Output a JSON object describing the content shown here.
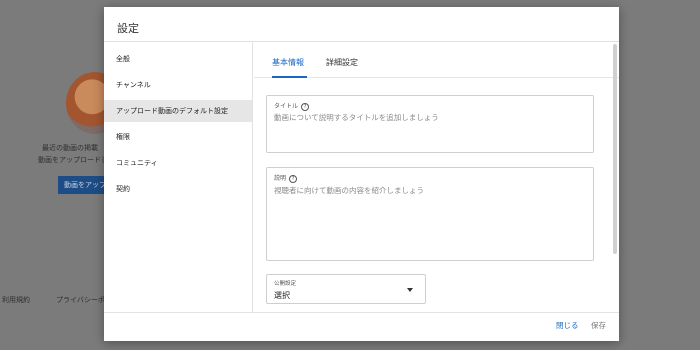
{
  "background": {
    "caption_line1": "最近の動画の掲載",
    "caption_line2": "動画をアップロードし",
    "upload_button": "動画をアップ",
    "footer_link_1": "利用規約",
    "footer_link_2": "プライバシーポ"
  },
  "dialog": {
    "title": "設定",
    "sidebar": {
      "items": [
        {
          "label": "全般"
        },
        {
          "label": "チャンネル"
        },
        {
          "label": "アップロード動画のデフォルト設定"
        },
        {
          "label": "権限"
        },
        {
          "label": "コミュニティ"
        },
        {
          "label": "契約"
        }
      ],
      "active_index": 2
    },
    "tabs": [
      {
        "label": "基本情報"
      },
      {
        "label": "詳細設定"
      }
    ],
    "title_field": {
      "label": "タイトル",
      "placeholder": "動画について説明するタイトルを追加しましょう"
    },
    "description_field": {
      "label": "説明",
      "placeholder": "視聴者に向けて動画の内容を紹介しましょう"
    },
    "visibility_select": {
      "label": "公開設定",
      "value": "選択"
    },
    "footer": {
      "close": "閉じる",
      "save": "保存"
    }
  },
  "colors": {
    "accent": "#1a66c4",
    "overlay": "#7b7b7b",
    "sidebar_active": "#e6e6e6"
  },
  "icons": {
    "help": "help-circle-icon",
    "dropdown": "caret-down-icon"
  }
}
